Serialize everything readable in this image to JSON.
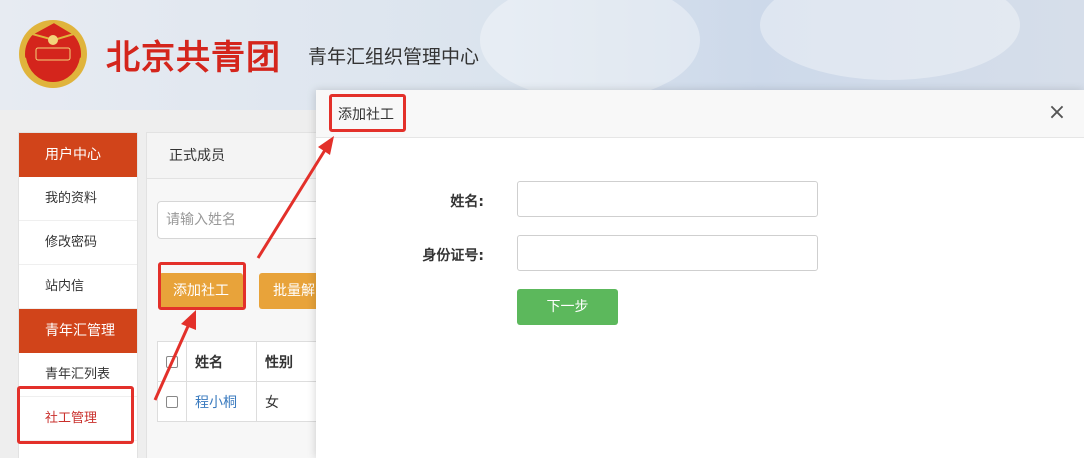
{
  "header": {
    "brand": "北京共青团",
    "subtitle": "青年汇组织管理中心",
    "emblem_text": "中国共青团"
  },
  "sidebar": {
    "group1": "用户中心",
    "items1": [
      "我的资料",
      "修改密码",
      "站内信"
    ],
    "group2": "青年汇管理",
    "items2": [
      "青年汇列表",
      "社工管理"
    ],
    "active": "社工管理"
  },
  "main": {
    "tab": "正式成员",
    "search_placeholder": "请输入姓名",
    "add_button": "添加社工",
    "batch_button": "批量解",
    "table": {
      "headers": [
        "姓名",
        "性别"
      ],
      "rows": [
        {
          "name": "程小桐",
          "gender": "女"
        }
      ]
    }
  },
  "modal": {
    "title": "添加社工",
    "close": "×",
    "fields": [
      {
        "label": "姓名:",
        "value": "",
        "placeholder": ""
      },
      {
        "label": "身份证号:",
        "value": "",
        "placeholder": ""
      }
    ],
    "next_button": "下一步"
  },
  "colors": {
    "brand_red": "#d4251c",
    "sidebar_active_bg": "#d1441a",
    "add_button": "#e8a33a",
    "next_button": "#5cb85c",
    "annotation_red": "#e3302a"
  }
}
